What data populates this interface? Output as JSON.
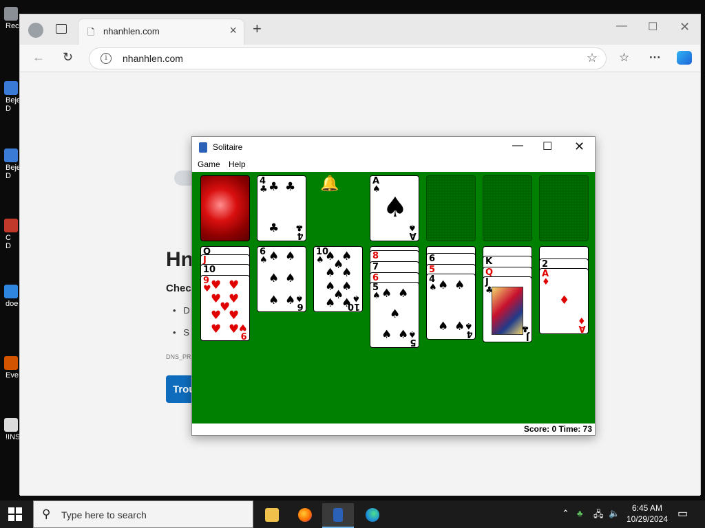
{
  "desktop": {
    "icons": [
      {
        "label": "Rec"
      },
      {
        "label": "Beje\nD"
      },
      {
        "label": "Beje\nD"
      },
      {
        "label": "C\nD"
      },
      {
        "label": "doe"
      },
      {
        "label": "Eve"
      },
      {
        "label": "!INST"
      }
    ]
  },
  "browser": {
    "tab_title": "nhanhlen.com",
    "url": "nhanhlen.com",
    "page": {
      "heading": "Hn",
      "subheading": "Check",
      "bullets": [
        "D",
        "S"
      ],
      "code": "DNS_PR",
      "button": "Trou"
    }
  },
  "solitaire": {
    "title": "Solitaire",
    "menu": [
      "Game",
      "Help"
    ],
    "status": "Score: 0 Time: 73"
  },
  "taskbar": {
    "search_placeholder": "Type here to search",
    "time": "6:45 AM",
    "date": "10/29/2024"
  },
  "colors": {
    "felt": "#008000",
    "card_red": "#e00000",
    "accent": "#0f6cbd"
  }
}
